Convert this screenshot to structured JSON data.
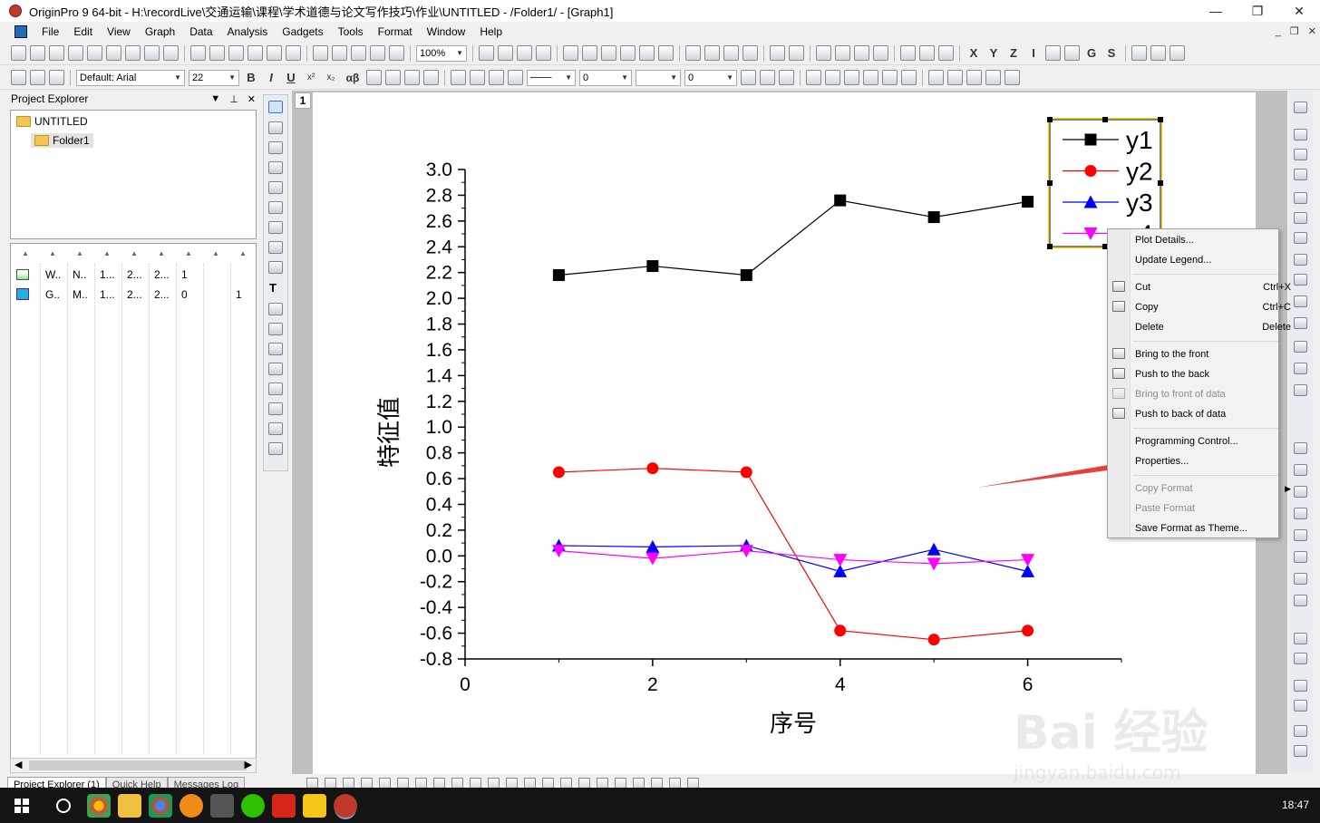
{
  "window": {
    "title": "OriginPro 9 64-bit - H:\\recordLive\\交通运输\\课程\\学术道德与论文写作技巧\\作业\\UNTITLED - /Folder1/ - [Graph1]",
    "controls": {
      "minimize": "—",
      "maximize": "❐",
      "close": "✕"
    }
  },
  "menubar": {
    "items": [
      "File",
      "Edit",
      "View",
      "Graph",
      "Data",
      "Analysis",
      "Gadgets",
      "Tools",
      "Format",
      "Window",
      "Help"
    ],
    "mdi_controls": {
      "minimize": "_",
      "restore": "❐",
      "close": "✕"
    }
  },
  "toolbar1": {
    "zoom_value": "100%"
  },
  "toolbar2": {
    "font_name": "Default: Arial",
    "font_size": "22",
    "bold": "B",
    "italic": "I",
    "underline": "U",
    "superscript": "x²",
    "subscript": "x₂",
    "greek": "αβ",
    "line_width_value": "0",
    "pattern_value": "0"
  },
  "project_explorer": {
    "title": "Project Explorer",
    "root": "UNTITLED",
    "folder": "Folder1",
    "rows": [
      {
        "c1": "W..",
        "c2": "N..",
        "c3": "1...",
        "c4": "2...",
        "c5": "2...",
        "c6": "1",
        "c8": ""
      },
      {
        "c1": "G..",
        "c2": "M..",
        "c3": "1...",
        "c4": "2...",
        "c5": "2...",
        "c6": "0",
        "c8": "1"
      }
    ],
    "tabs": [
      "Project Explorer (1)",
      "Quick Help",
      "Messages Log"
    ]
  },
  "graph": {
    "layer_label": "1"
  },
  "chart_data": {
    "type": "line",
    "title": "",
    "xlabel": "序号",
    "ylabel": "特征值",
    "xlim": [
      0,
      7
    ],
    "ylim": [
      -0.8,
      3.0
    ],
    "x_ticks": [
      "0",
      "2",
      "4",
      "6"
    ],
    "y_ticks": [
      "-0.8",
      "-0.6",
      "-0.4",
      "-0.2",
      "0.0",
      "0.2",
      "0.4",
      "0.6",
      "0.8",
      "1.0",
      "1.2",
      "1.4",
      "1.6",
      "1.8",
      "2.0",
      "2.2",
      "2.4",
      "2.6",
      "2.8",
      "3.0"
    ],
    "legend_position": "top-right",
    "x": [
      1,
      2,
      3,
      4,
      5,
      6
    ],
    "series": [
      {
        "name": "y1",
        "color": "#000000",
        "marker": "square",
        "values": [
          2.18,
          2.25,
          2.18,
          2.76,
          2.63,
          2.75
        ]
      },
      {
        "name": "y2",
        "color": "#ff0000",
        "marker": "circle",
        "values": [
          0.65,
          0.68,
          0.65,
          -0.58,
          -0.65,
          -0.58
        ]
      },
      {
        "name": "y3",
        "color": "#0000ff",
        "marker": "triangle-up",
        "values": [
          0.08,
          0.07,
          0.08,
          -0.12,
          0.05,
          -0.12
        ]
      },
      {
        "name": "y4",
        "color": "#ff00ff",
        "marker": "triangle-down",
        "values": [
          0.04,
          -0.02,
          0.04,
          -0.03,
          -0.06,
          -0.03
        ]
      }
    ]
  },
  "context_menu": {
    "items": [
      {
        "label": "Plot Details...",
        "shortcut": "",
        "disabled": false
      },
      {
        "label": "Update Legend...",
        "shortcut": "",
        "disabled": false
      },
      {
        "label": "Cut",
        "shortcut": "Ctrl+X",
        "disabled": false
      },
      {
        "label": "Copy",
        "shortcut": "Ctrl+C",
        "disabled": false
      },
      {
        "label": "Delete",
        "shortcut": "Delete",
        "disabled": false
      },
      {
        "label": "Bring to the front",
        "shortcut": "",
        "disabled": false
      },
      {
        "label": "Push to the back",
        "shortcut": "",
        "disabled": false
      },
      {
        "label": "Bring to front of data",
        "shortcut": "",
        "disabled": true
      },
      {
        "label": "Push to back of data",
        "shortcut": "",
        "disabled": false
      },
      {
        "label": "Programming Control...",
        "shortcut": "",
        "disabled": false
      },
      {
        "label": "Properties...",
        "shortcut": "",
        "disabled": false
      },
      {
        "label": "Copy Format",
        "shortcut": "",
        "disabled": true
      },
      {
        "label": "Paste Format",
        "shortcut": "",
        "disabled": true
      },
      {
        "label": "Save Format as Theme...",
        "shortcut": "",
        "disabled": false
      }
    ]
  },
  "annotation": {
    "arrow_color": "#e8413c"
  },
  "watermark": {
    "main": "Bai 经验",
    "sub": "jingyan.baidu.com"
  },
  "taskbar": {
    "clock": "18:47"
  }
}
